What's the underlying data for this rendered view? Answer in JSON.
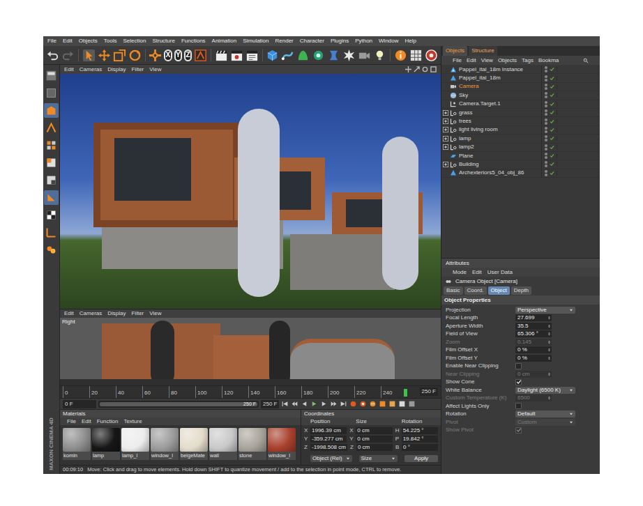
{
  "menu": [
    "File",
    "Edit",
    "Objects",
    "Tools",
    "Selection",
    "Structure",
    "Functions",
    "Animation",
    "Simulation",
    "Render",
    "Character",
    "Plugins",
    "Python",
    "Window",
    "Help"
  ],
  "toolbar": {
    "axes": [
      {
        "label": "X",
        "on": true
      },
      {
        "label": "Y",
        "on": true
      },
      {
        "label": "Z",
        "on": true
      }
    ]
  },
  "mode_tools": [
    {
      "selected": false
    },
    {
      "selected": false
    },
    {
      "selected": true
    },
    {
      "selected": false
    },
    {
      "selected": false
    },
    {
      "selected": false
    },
    {
      "selected": false
    },
    {
      "selected": true
    },
    {
      "selected": false
    },
    {
      "selected": false
    },
    {
      "selected": false
    }
  ],
  "logo": "MAXON CINEMA 4D",
  "viewport_perspective": {
    "menu": [
      "Edit",
      "Cameras",
      "Display",
      "Filter",
      "View"
    ]
  },
  "viewport_right": {
    "menu": [
      "Edit",
      "Cameras",
      "Display",
      "Filter",
      "View"
    ],
    "label": "Right"
  },
  "timeline": {
    "ticks": [
      "0",
      "20",
      "40",
      "60",
      "80",
      "100",
      "120",
      "140",
      "160",
      "180",
      "200",
      "220",
      "240"
    ],
    "end": "250 F"
  },
  "transport": {
    "current": "0 F",
    "range_end": "250 F",
    "max": "250 F",
    "range_level": 1
  },
  "materials": {
    "title": "Materials",
    "menu": [
      "File",
      "Edit",
      "Function",
      "Texture"
    ],
    "items": [
      {
        "name": "komin",
        "color": "#8e8e8e"
      },
      {
        "name": "lamp",
        "color": "#161616"
      },
      {
        "name": "lamp_l",
        "color": "#ececec"
      },
      {
        "name": "window_l",
        "color": "#9c9c9c"
      },
      {
        "name": "beigeMate",
        "color": "#e4dccb"
      },
      {
        "name": "wall",
        "color": "#c9c9c9"
      },
      {
        "name": "stone",
        "color": "#a9a49b"
      },
      {
        "name": "window_l",
        "color": "#a8402c"
      }
    ]
  },
  "coordinates": {
    "title": "Coordinates",
    "columns": [
      "Position",
      "Size",
      "Rotation"
    ],
    "rows": [
      {
        "position_axis": "X",
        "position": "1996.39 cm",
        "size_axis": "X",
        "size": "0 cm",
        "rotation_axis": "H",
        "rotation": "54.225 °"
      },
      {
        "position_axis": "Y",
        "position": "-359.277 cm",
        "size_axis": "Y",
        "size": "0 cm",
        "rotation_axis": "P",
        "rotation": "19.842 °"
      },
      {
        "position_axis": "Z",
        "position": "-1998.508 cm",
        "size_axis": "Z",
        "size": "0 cm",
        "rotation_axis": "B",
        "rotation": "0 °"
      }
    ],
    "mode": "Object (Rel)",
    "size_mode": "Size",
    "apply": "Apply"
  },
  "status_bar": {
    "time": "00:09:10",
    "message": "Move: Click and drag to move elements. Hold down SHIFT to quantize movement / add to the selection in point mode, CTRL to remove."
  },
  "objects": {
    "tabs": [
      {
        "label": "Objects",
        "selected": true
      },
      {
        "label": "Structure",
        "selected": false
      }
    ],
    "menu": [
      "File",
      "Edit",
      "View",
      "Objects",
      "Tags",
      "Bookma"
    ],
    "items": [
      {
        "name": "Pappel_ital_18m Instance",
        "kind": "instance",
        "selected": false,
        "expandable": false
      },
      {
        "name": "Pappel_ital_18m",
        "kind": "polygon",
        "selected": false,
        "expandable": false
      },
      {
        "name": "Camera",
        "kind": "camera",
        "selected": true,
        "expandable": false
      },
      {
        "name": "Sky",
        "kind": "sky",
        "selected": false,
        "expandable": false
      },
      {
        "name": "Camera.Target.1",
        "kind": "target",
        "selected": false,
        "expandable": false
      },
      {
        "name": "grass",
        "kind": "null",
        "selected": false,
        "expandable": true
      },
      {
        "name": "trees",
        "kind": "null",
        "selected": false,
        "expandable": true
      },
      {
        "name": "light living room",
        "kind": "null",
        "selected": false,
        "expandable": true
      },
      {
        "name": "lamp",
        "kind": "null",
        "selected": false,
        "expandable": true
      },
      {
        "name": "lamp2",
        "kind": "null",
        "selected": false,
        "expandable": true
      },
      {
        "name": "Plane",
        "kind": "plane",
        "selected": false,
        "expandable": false
      },
      {
        "name": "Building",
        "kind": "null",
        "selected": false,
        "expandable": true
      },
      {
        "name": "Archexteriors5_04_obj_86",
        "kind": "polygon",
        "selected": false,
        "expandable": false
      }
    ]
  },
  "attributes": {
    "title": "Attributes",
    "menu": [
      "Mode",
      "Edit",
      "User Data"
    ],
    "object_title": "Camera Object [Camera]",
    "tabs": [
      {
        "label": "Basic",
        "selected": false
      },
      {
        "label": "Coord.",
        "selected": false
      },
      {
        "label": "Object",
        "selected": true
      },
      {
        "label": "Depth",
        "selected": false
      }
    ],
    "section": "Object Properties",
    "fields": [
      {
        "label": "Projection",
        "kind": "dropdown",
        "value": "Perspective",
        "disabled": false
      },
      {
        "label": "Focal Length",
        "kind": "number",
        "value": "27.699",
        "disabled": false
      },
      {
        "label": "Aperture Width",
        "kind": "number",
        "value": "35.5",
        "disabled": false
      },
      {
        "label": "Field of View",
        "kind": "number",
        "value": "65.306 °",
        "disabled": false
      },
      {
        "label": "Zoom",
        "kind": "number",
        "value": "0.145",
        "disabled": true
      },
      {
        "label": "Film Offset X",
        "kind": "number",
        "value": "0 %",
        "disabled": false
      },
      {
        "label": "Film Offset Y",
        "kind": "number",
        "value": "0 %",
        "disabled": false
      },
      {
        "label": "Enable Near Clipping",
        "kind": "checkbox",
        "checked": false,
        "disabled": false
      },
      {
        "label": "Near Clipping",
        "kind": "number",
        "value": "0 cm",
        "disabled": true
      },
      {
        "label": "Show Cone",
        "kind": "checkbox",
        "checked": true,
        "disabled": false
      },
      {
        "label": "White Balance",
        "kind": "dropdown",
        "value": "Daylight (6500 K)",
        "disabled": false
      },
      {
        "label": "Custom Temperature (K)",
        "kind": "number",
        "value": "6500",
        "disabled": true
      },
      {
        "label": "Affect Lights Only",
        "kind": "checkbox",
        "checked": false,
        "disabled": false
      },
      {
        "label": "Rotation",
        "kind": "dropdown",
        "value": "Default",
        "disabled": false
      },
      {
        "label": "Pivot",
        "kind": "dropdown",
        "value": "Custom",
        "disabled": true
      },
      {
        "label": "Show Pivot",
        "kind": "checkbox",
        "checked": true,
        "disabled": true
      }
    ]
  }
}
